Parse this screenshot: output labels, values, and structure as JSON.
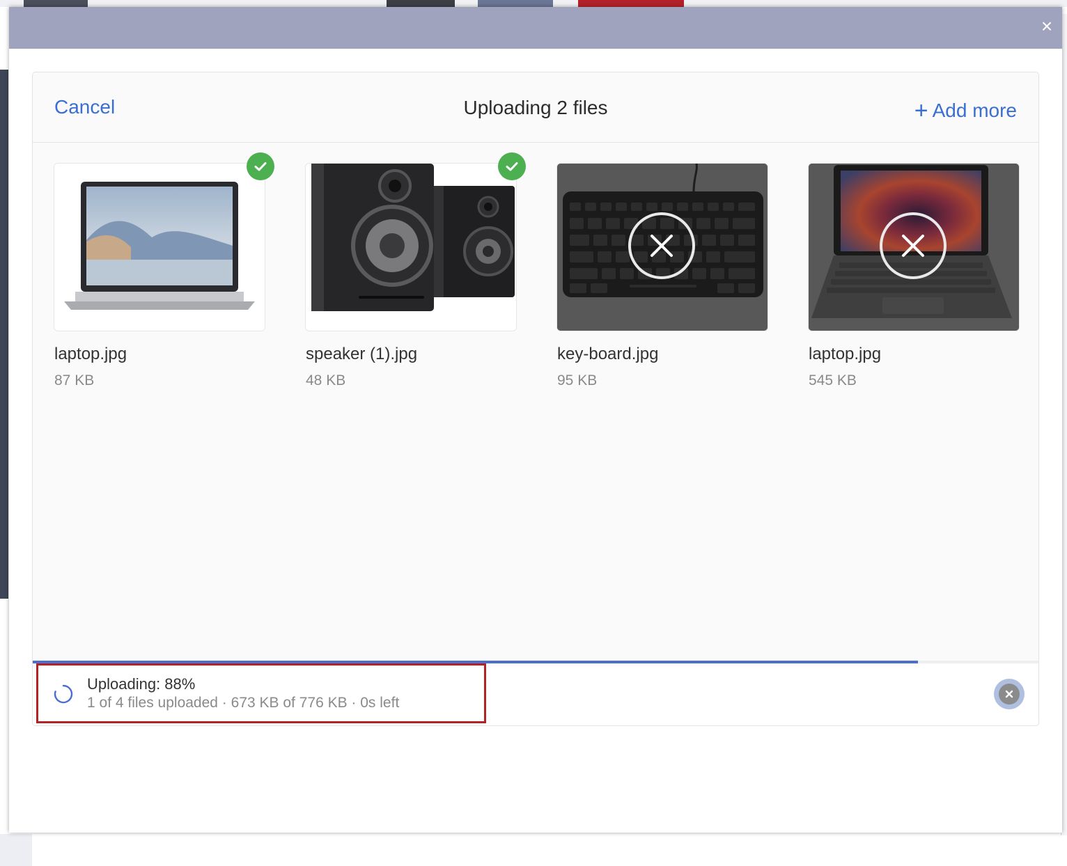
{
  "modal": {
    "close_glyph": "×"
  },
  "dashboard": {
    "cancel_label": "Cancel",
    "title": "Uploading 2 files",
    "add_more_label": "Add more",
    "add_more_icon": "plus-icon"
  },
  "files": [
    {
      "name": "laptop.jpg",
      "size": "87 KB",
      "state": "complete",
      "thumbnail": "laptop-photo"
    },
    {
      "name": "speaker (1).jpg",
      "size": "48 KB",
      "state": "complete",
      "thumbnail": "speakers-photo"
    },
    {
      "name": "key-board.jpg",
      "size": "95 KB",
      "state": "removable",
      "thumbnail": "keyboard-photo"
    },
    {
      "name": "laptop.jpg",
      "size": "545 KB",
      "state": "removable",
      "thumbnail": "laptop-colorful-photo"
    }
  ],
  "status": {
    "title": "Uploading: 88%",
    "subtitle": "1 of 4 files uploaded · 673 KB of 776 KB · 0s left",
    "progress_percent": 88,
    "spinner_icon": "loading-spinner-icon",
    "cancel_icon": "cancel-upload-icon"
  },
  "colors": {
    "accent": "#3a6fd2",
    "success": "#4caf50",
    "header": "#9fa3bd",
    "highlight": "#b42323"
  }
}
